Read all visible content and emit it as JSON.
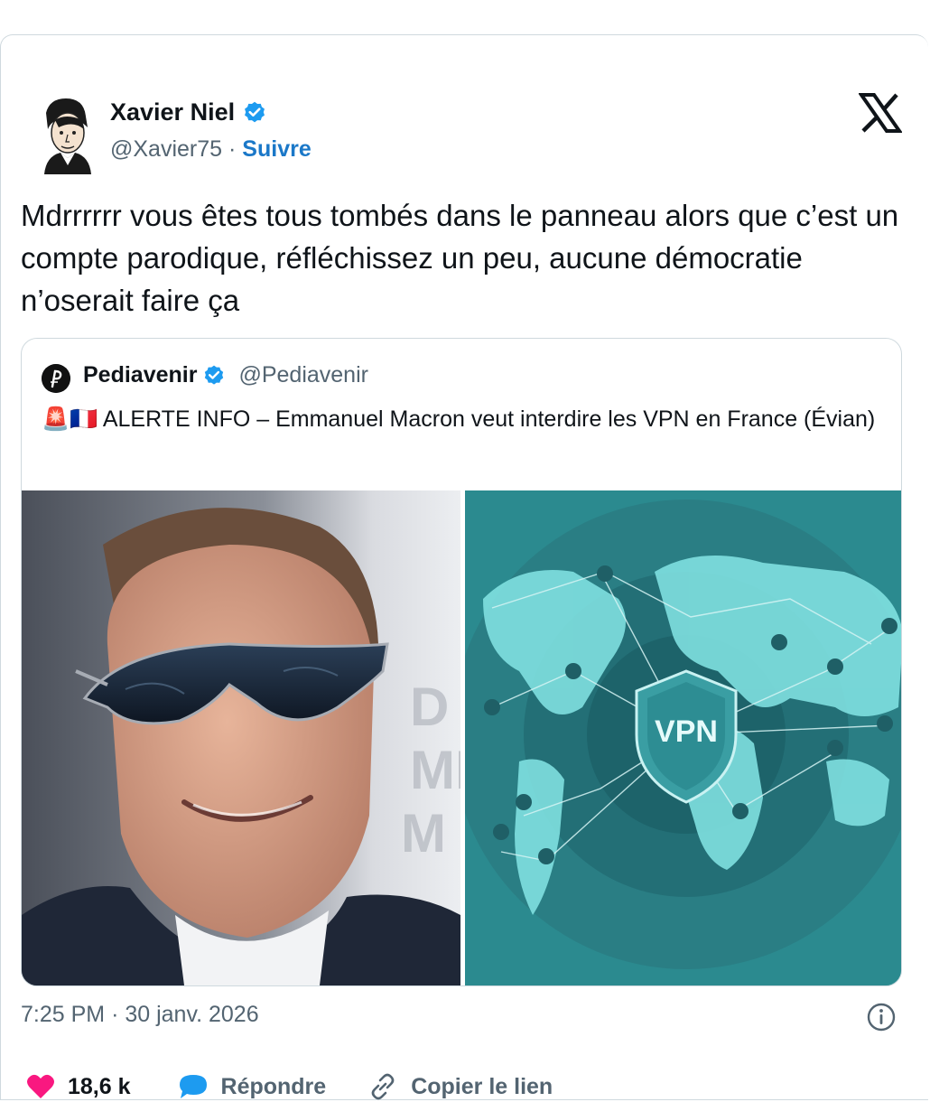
{
  "author": {
    "name": "Xavier Niel",
    "handle": "@Xavier75",
    "separator": "·",
    "follow_label": "Suivre"
  },
  "tweet": {
    "text": "Mdrrrrrr vous êtes tous tombés dans le panneau alors que c’est un compte parodique, réfléchissez un peu, aucune démocratie n’oserait faire ça"
  },
  "quote": {
    "name": "Pediavenir",
    "handle": "@Pediavenir",
    "text": "🚨🇫🇷 ALERTE INFO – Emmanuel Macron veut interdire les VPN en France (Évian)",
    "image_right_label": "VPN"
  },
  "meta": {
    "time": "7:25 PM",
    "separator": "·",
    "date": "30 janv. 2026"
  },
  "actions": {
    "likes": "18,6 k",
    "reply_label": "Répondre",
    "copy_link_label": "Copier le lien"
  },
  "colors": {
    "accent": "#1d9bf0",
    "like": "#f91880",
    "text": "#0f1419",
    "muted": "#536471",
    "border": "#cfd9de"
  },
  "icons": [
    "cartoon-avatar",
    "verified-badge-icon",
    "x-logo-icon",
    "info-icon",
    "heart-icon",
    "reply-bubble-icon",
    "link-icon"
  ]
}
